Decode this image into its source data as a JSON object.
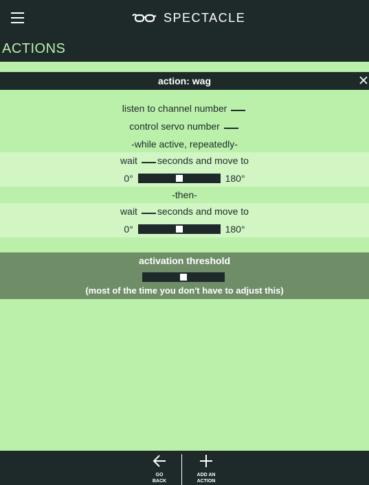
{
  "app": {
    "name": "SPECTACLE",
    "logo_icon": "glasses-icon",
    "menu_icon": "hamburger-menu-icon"
  },
  "section": {
    "title": "ACTIONS"
  },
  "action": {
    "header": "action: wag",
    "close_icon": "close-icon",
    "listen_label": "listen to channel number",
    "servo_label": "control servo number",
    "while_active": "-while active, repeatedly-",
    "step1": {
      "wait_label": "wait",
      "seconds_label": "seconds and move to",
      "min_label": "0°",
      "max_label": "180°",
      "position_fraction": 0.5
    },
    "then_label": "-then-",
    "step2": {
      "wait_label": "wait",
      "seconds_label": "seconds and move to",
      "min_label": "0°",
      "max_label": "180°",
      "position_fraction": 0.5
    }
  },
  "threshold": {
    "title": "activation threshold",
    "note": "(most of the time you don't have to adjust this)",
    "position_fraction": 0.5
  },
  "bottom_nav": {
    "back": {
      "line1": "GO",
      "line2": "BACK",
      "icon": "arrow-left-icon"
    },
    "add": {
      "line1": "ADD AN",
      "line2": "ACTION",
      "icon": "plus-icon"
    }
  },
  "colors": {
    "dark": "#1e2a2a",
    "accent": "#bbf0ab",
    "band": "#d1f6c4",
    "panel": "#6f8e68"
  }
}
